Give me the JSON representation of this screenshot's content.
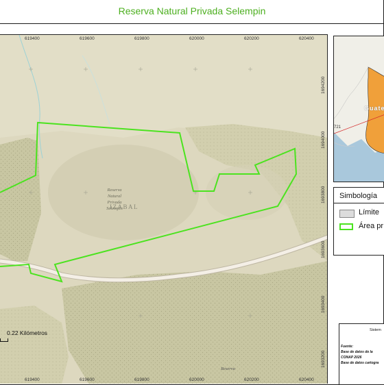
{
  "title": "Reserva Natural Privada Selempin",
  "map": {
    "x_ticks": [
      "619400",
      "619600",
      "619800",
      "620000",
      "620200",
      "620400"
    ],
    "y_ticks": [
      "1694200",
      "1694000",
      "1693800",
      "1693600",
      "1693400",
      "1693200"
    ],
    "x_ticks_bottom": [
      "619400",
      "619600",
      "619800",
      "620000",
      "620200",
      "620400"
    ],
    "reserve_label": "Reserva Natural Privada Selempin",
    "reserve_label_lines": [
      "Reserva",
      "Natural",
      "Privada",
      "Selempin"
    ],
    "region_label": "IZABAL",
    "bottom_label": "Reserva",
    "scale_label": "0.22 Kilómetros",
    "inset_label": "Guate",
    "inset_number": "721",
    "colors": {
      "reserve_outline": "#4be31f",
      "terrain": "#d9d4b8",
      "forest": "#c9c9a4"
    }
  },
  "legend": {
    "title": "Simbología",
    "items": [
      {
        "label": "Límite"
      },
      {
        "label": "Área pr"
      }
    ]
  },
  "info": {
    "heading": "Sistem",
    "fuente": "Fuente:",
    "line1": "Base de datos de la",
    "line2": "CONAP 2026",
    "line3": "Base de datos cartogra"
  }
}
